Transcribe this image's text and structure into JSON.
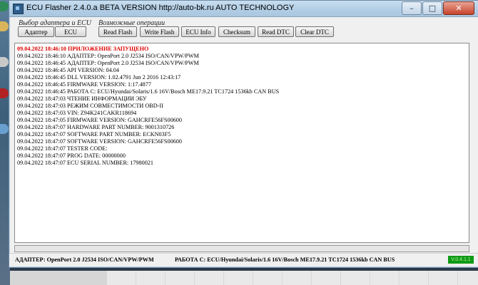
{
  "window": {
    "title": "ECU Flasher 2.4.0.a BETA VERSION  http://auto-bk.ru  AUTO TECHNOLOGY",
    "controls": {
      "minimize": "–",
      "maximize": "□",
      "close": "✕"
    }
  },
  "groups": {
    "adapter_ecu_label": "Выбор адаптера и ECU",
    "operations_label": "Возможные операции"
  },
  "buttons": {
    "adapter": "Адаптер",
    "ecu": "ECU",
    "read_flash": "Read Flash",
    "write_flash": "Write Flash",
    "ecu_info": "ECU Info",
    "checksum": "Checksum",
    "read_dtc": "Read DTC",
    "clear_dtc": "Clear DTC"
  },
  "log": [
    "09.04.2022 18:46:10 ПРИЛОЖЕНИЕ ЗАПУЩЕНО",
    "09.04.2022 18:46:10 АДАПТЕР: OpenPort 2.0 J2534 ISO/CAN/VPW/PWM",
    "09.04.2022 18:46:45 АДАПТЕР: OpenPort 2.0 J2534 ISO/CAN/VPW/PWM",
    "09.04.2022 18:46:45 API VERSION: 04.04",
    "09.04.2022 18:46:45 DLL VERSION: 1.02.4791 Jun  2 2016 12:43:17",
    "09.04.2022 18:46:45 FIRMWARE VERSION: 1:17.4877",
    "09.04.2022 18:46:45 РАБОТА С: ECU/Hyundai/Solaris/1.6 16V/Bosch ME17.9.21 TC1724 1536kb CAN BUS",
    "09.04.2022 18:47:03 ЧТЕНИЕ ИНФОРМАЦИИ ЭБУ",
    "09.04.2022 18:47:03 РЕЖИМ СОВМЕСТИМОСТИ OBD-II",
    "09.04.2022 18:47:03 VIN: Z94K241CAKR118694",
    "09.04.2022 18:47:05 FIRMWARE VERSION: GAHCRFE56FS00600",
    "09.04.2022 18:47:07 HARDWARE PART NUMBER: 9001310726",
    "09.04.2022 18:47:07 SOFTWARE PART NUMBER: ECKN03F5",
    "09.04.2022 18:47:07 SOFTWARE VERSION: GAHCRFE56FS00600",
    "09.04.2022 18:47:07 TESTER CODE:",
    "09.04.2022 18:47:07 PROG DATE: 00000000",
    "09.04.2022 18:47:07 ECU SERIAL NUMBER: 17980021"
  ],
  "progress": {
    "value": 0
  },
  "status": {
    "adapter": "АДАПТЕР: OpenPort 2.0 J2534 ISO/CAN/VPW/PWM",
    "ecu": "РАБОТА С: ECU/Hyundai/Solaris/1.6 16V/Bosch ME17.9.21 TC1724 1536kb CAN BUS",
    "badge": "V.0.4.1.1",
    "badge_color": "#0f9a15"
  },
  "colors": {
    "log_first_line": "#e00000",
    "progress_fill": "#36c236"
  }
}
